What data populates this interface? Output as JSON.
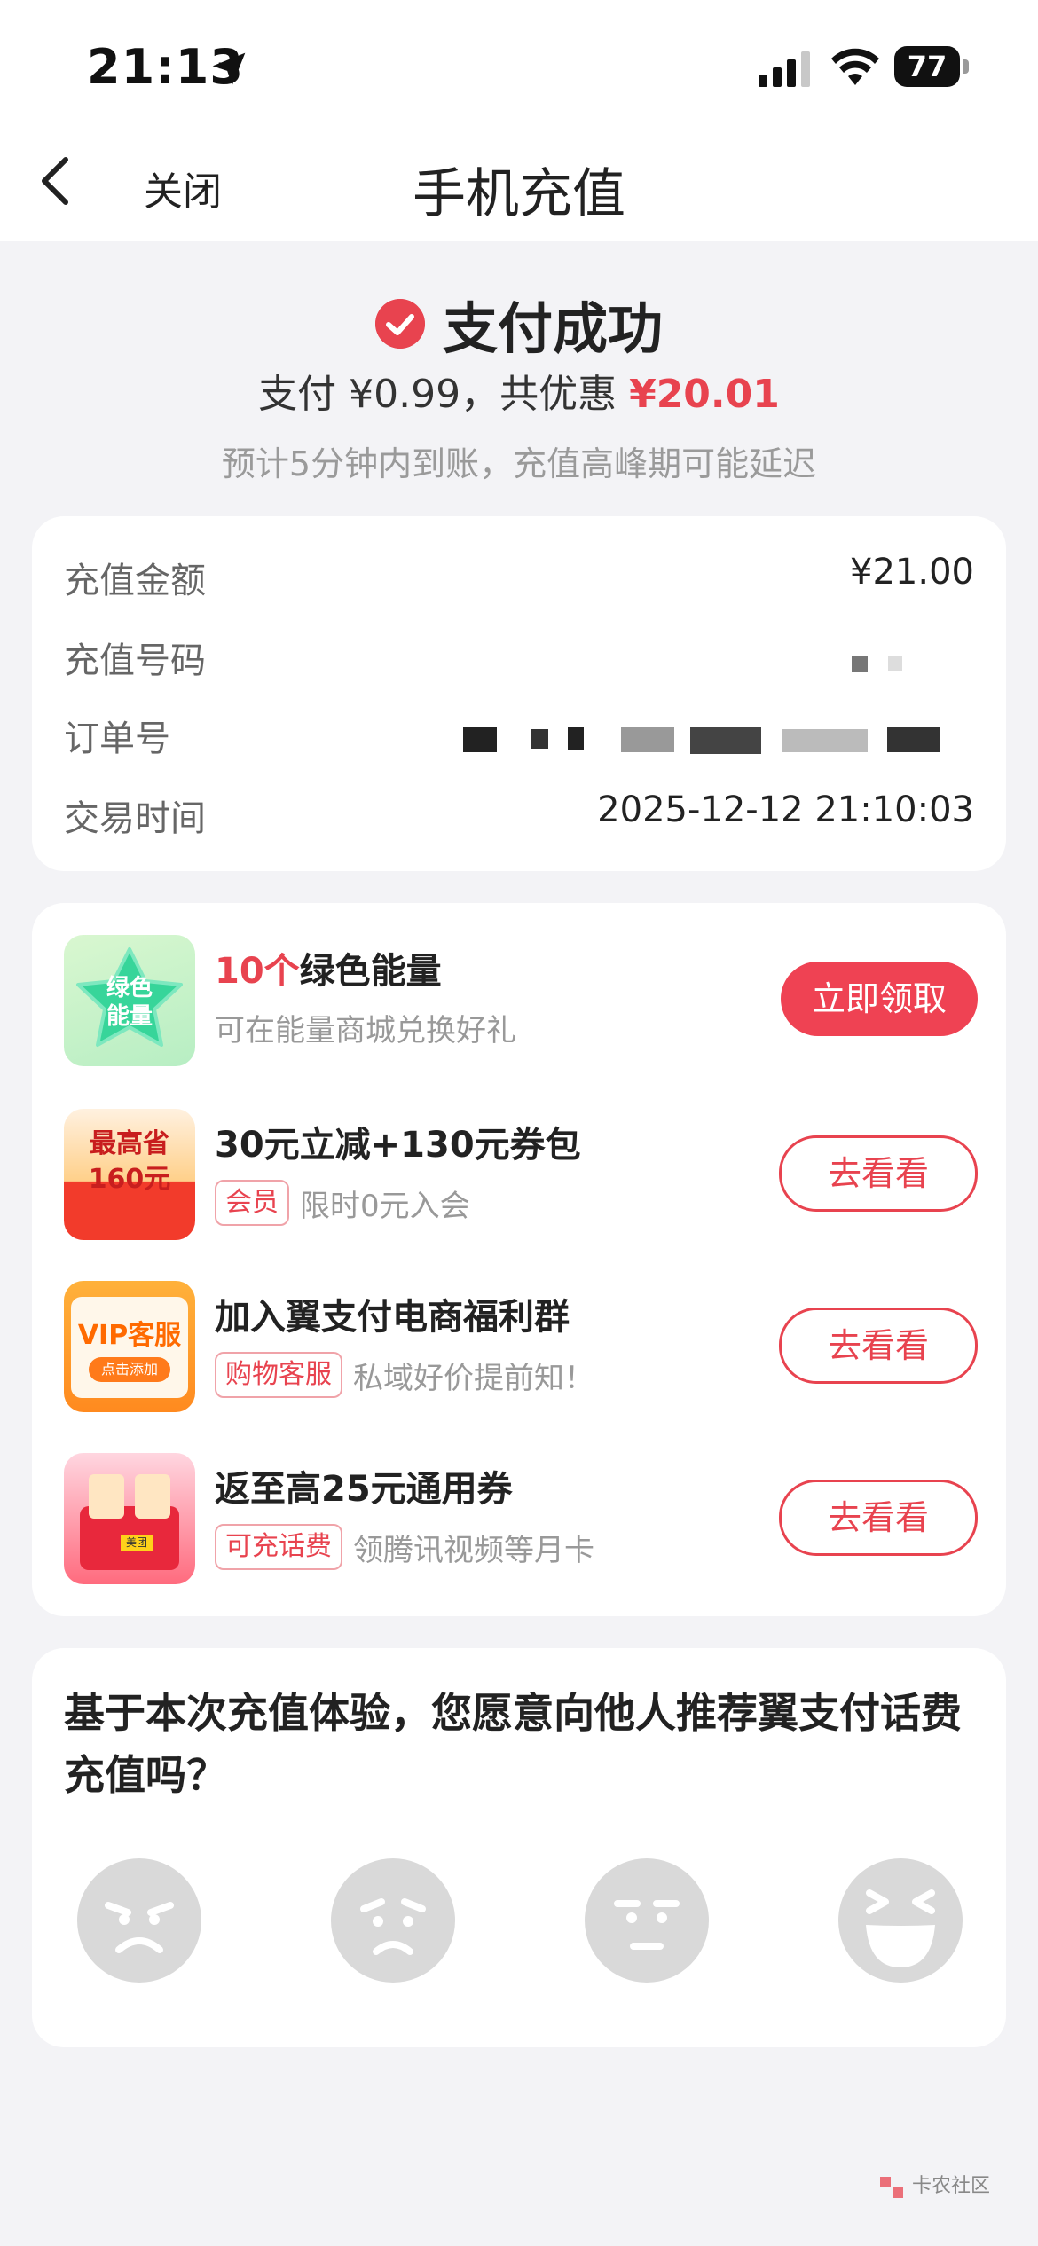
{
  "status_bar": {
    "time": "21:13",
    "battery": "77"
  },
  "nav": {
    "close_label": "关闭",
    "title": "手机充值"
  },
  "result": {
    "title": "支付成功",
    "pay_prefix": "支付 ",
    "pay_amount": "¥0.99",
    "discount_prefix": "，共优惠 ",
    "discount_amount": "¥20.01",
    "eta": "预计5分钟内到账，充值高峰期可能延迟"
  },
  "info": {
    "amount_label": "充值金额",
    "amount_value": "¥21.00",
    "number_label": "充值号码",
    "order_label": "订单号",
    "time_label": "交易时间",
    "time_value": "2025-12-12  21:10:03"
  },
  "promos": [
    {
      "img_text": "绿色\n能量",
      "title_red": "10个",
      "title": "绿色能量",
      "subtitle": "可在能量商城兑换好礼",
      "button": "立即领取"
    },
    {
      "img_text": "最高省160元",
      "title": "30元立减+130元券包",
      "tag": "会员",
      "subtitle": "限时0元入会",
      "button": "去看看"
    },
    {
      "img_text": "VIP客服",
      "img_subtext": "点击添加",
      "title": "加入翼支付电商福利群",
      "tag": "购物客服",
      "subtitle": "私域好价提前知！",
      "button": "去看看"
    },
    {
      "img_text": "美团",
      "title": "返至高25元通用券",
      "tag": "可充话费",
      "subtitle": "领腾讯视频等月卡",
      "button": "去看看"
    }
  ],
  "survey": {
    "question": "基于本次充值体验，您愿意向他人推荐翼支付话费充值吗？",
    "faces": [
      "angry-face-icon",
      "sad-face-icon",
      "neutral-face-icon",
      "laughing-face-icon"
    ]
  },
  "watermark": "卡农社区",
  "colors": {
    "accent": "#e8434f",
    "background": "#f3f3f6"
  }
}
